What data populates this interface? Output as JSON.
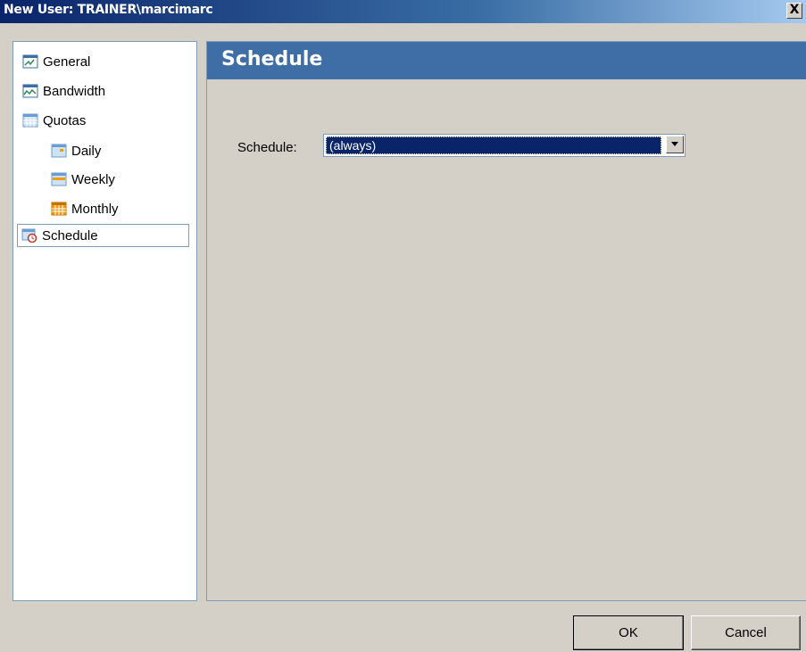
{
  "window": {
    "title": "New User: TRAINER\\marcimarc",
    "close_glyph": "X"
  },
  "tree": {
    "items": [
      {
        "label": "General",
        "icon": "general-icon",
        "level": 0,
        "selected": false
      },
      {
        "label": "Bandwidth",
        "icon": "bandwidth-icon",
        "level": 0,
        "selected": false
      },
      {
        "label": "Quotas",
        "icon": "quotas-icon",
        "level": 0,
        "selected": false
      },
      {
        "label": "Daily",
        "icon": "daily-calendar-icon",
        "level": 1,
        "selected": false
      },
      {
        "label": "Weekly",
        "icon": "weekly-calendar-icon",
        "level": 1,
        "selected": false
      },
      {
        "label": "Monthly",
        "icon": "monthly-calendar-icon",
        "level": 1,
        "selected": false
      },
      {
        "label": "Schedule",
        "icon": "schedule-clock-icon",
        "level": 0,
        "selected": true
      }
    ]
  },
  "panel": {
    "title": "Schedule",
    "schedule_label": "Schedule:",
    "schedule_value": "(always)"
  },
  "buttons": {
    "ok": "OK",
    "cancel": "Cancel"
  },
  "colors": {
    "header": "#3e6ea5",
    "selection": "#0a246a",
    "dialog": "#d4d0c8"
  }
}
